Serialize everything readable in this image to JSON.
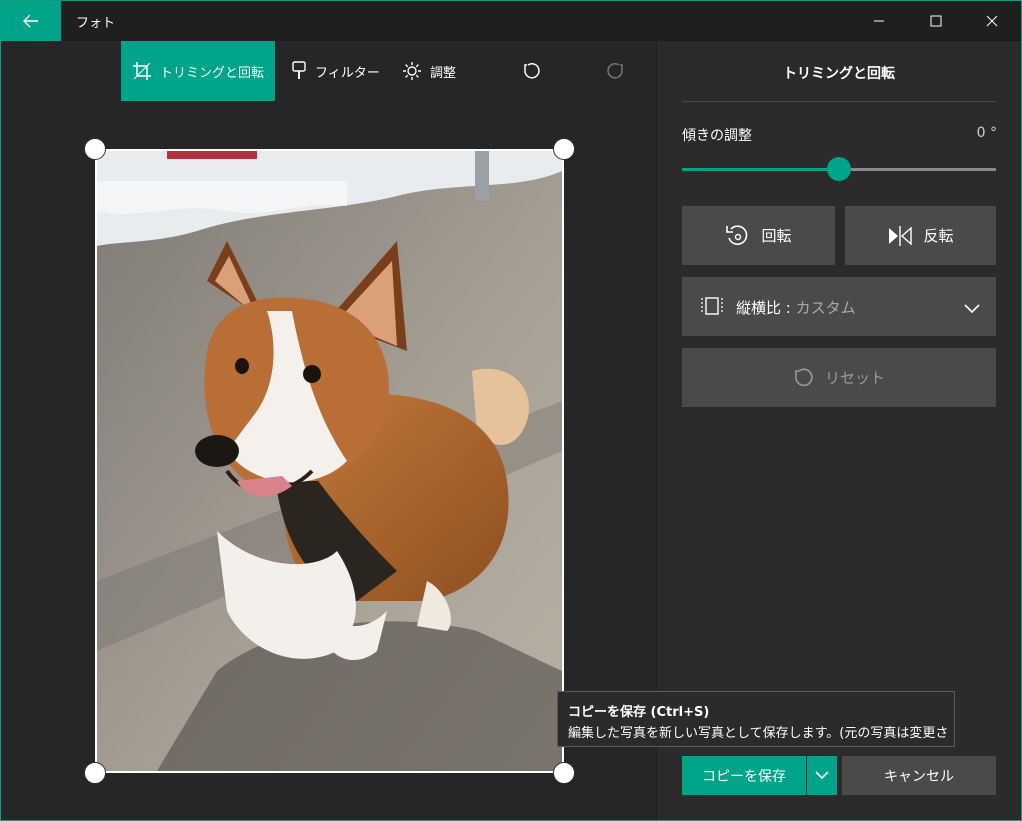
{
  "window": {
    "title": "フォト"
  },
  "toolbar": {
    "crop_label": "トリミングと回転",
    "filter_label": "フィルター",
    "adjust_label": "調整"
  },
  "panel": {
    "title": "トリミングと回転",
    "tilt_label": "傾きの調整",
    "tilt_value": "0 °",
    "tilt_fraction": 0.5,
    "rotate_label": "回転",
    "flip_label": "反転",
    "aspect_label": "縦横比 : ",
    "aspect_value": "カスタム",
    "reset_label": "リセット"
  },
  "footer": {
    "save_label": "コピーを保存",
    "cancel_label": "キャンセル"
  },
  "tooltip": {
    "title": "コピーを保存 (Ctrl+S)",
    "body": "編集した写真を新しい写真として保存します。(元の写真は変更さ"
  },
  "colors": {
    "accent": "#00a489",
    "panel": "#2b2b2b",
    "canvas": "#262626",
    "button": "#4a4a4a"
  }
}
